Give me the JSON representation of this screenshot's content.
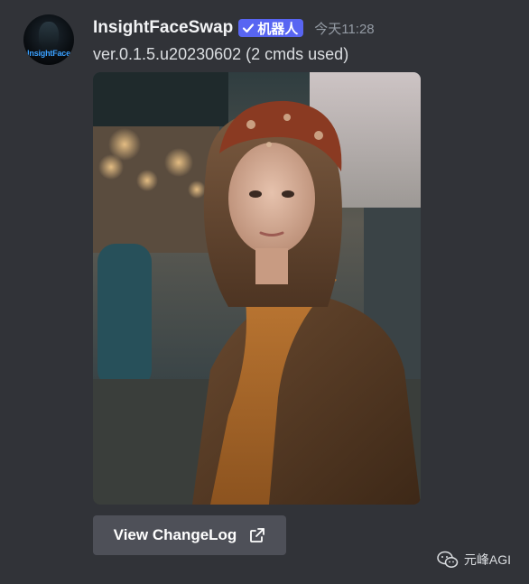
{
  "message": {
    "author": {
      "avatar_text": "InsightFace",
      "username": "InsightFaceSwap",
      "bot_tag": "机器人"
    },
    "timestamp": "今天11:28",
    "text": "ver.0.1.5.u20230602 (2 cmds used)",
    "image": {
      "icon": "photo-portrait"
    },
    "button": {
      "label": "View ChangeLog",
      "icon": "external-link-icon"
    }
  },
  "watermark": {
    "text": "元峰AGI",
    "icon": "wechat-icon"
  },
  "colors": {
    "background": "#313338",
    "bot_tag": "#5865f2",
    "button": "#4e5058",
    "timestamp": "#949ba4"
  }
}
